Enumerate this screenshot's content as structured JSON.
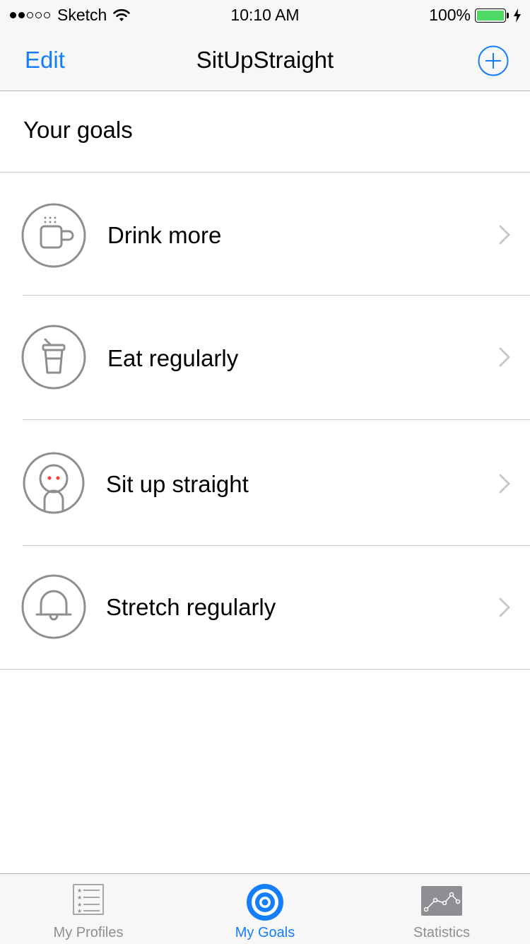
{
  "status_bar": {
    "carrier": "Sketch",
    "time": "10:10 AM",
    "battery": "100%"
  },
  "nav": {
    "edit_label": "Edit",
    "title": "SitUpStraight",
    "add_icon": "plus-circle-icon"
  },
  "section": {
    "title": "Your goals"
  },
  "goals": [
    {
      "label": "Drink more",
      "icon": "coffee-cup-icon"
    },
    {
      "label": "Eat regularly",
      "icon": "drink-cup-icon"
    },
    {
      "label": "Sit up straight",
      "icon": "person-icon"
    },
    {
      "label": "Stretch regularly",
      "icon": "bell-icon"
    }
  ],
  "tabs": [
    {
      "label": "My Profiles",
      "icon": "list-icon",
      "active": false
    },
    {
      "label": "My Goals",
      "icon": "target-icon",
      "active": true
    },
    {
      "label": "Statistics",
      "icon": "chart-icon",
      "active": false
    }
  ],
  "colors": {
    "accent": "#157efb",
    "icon_gray": "#8e8e93",
    "battery_green": "#4cd964",
    "face_eyes": "#ff3b30"
  }
}
